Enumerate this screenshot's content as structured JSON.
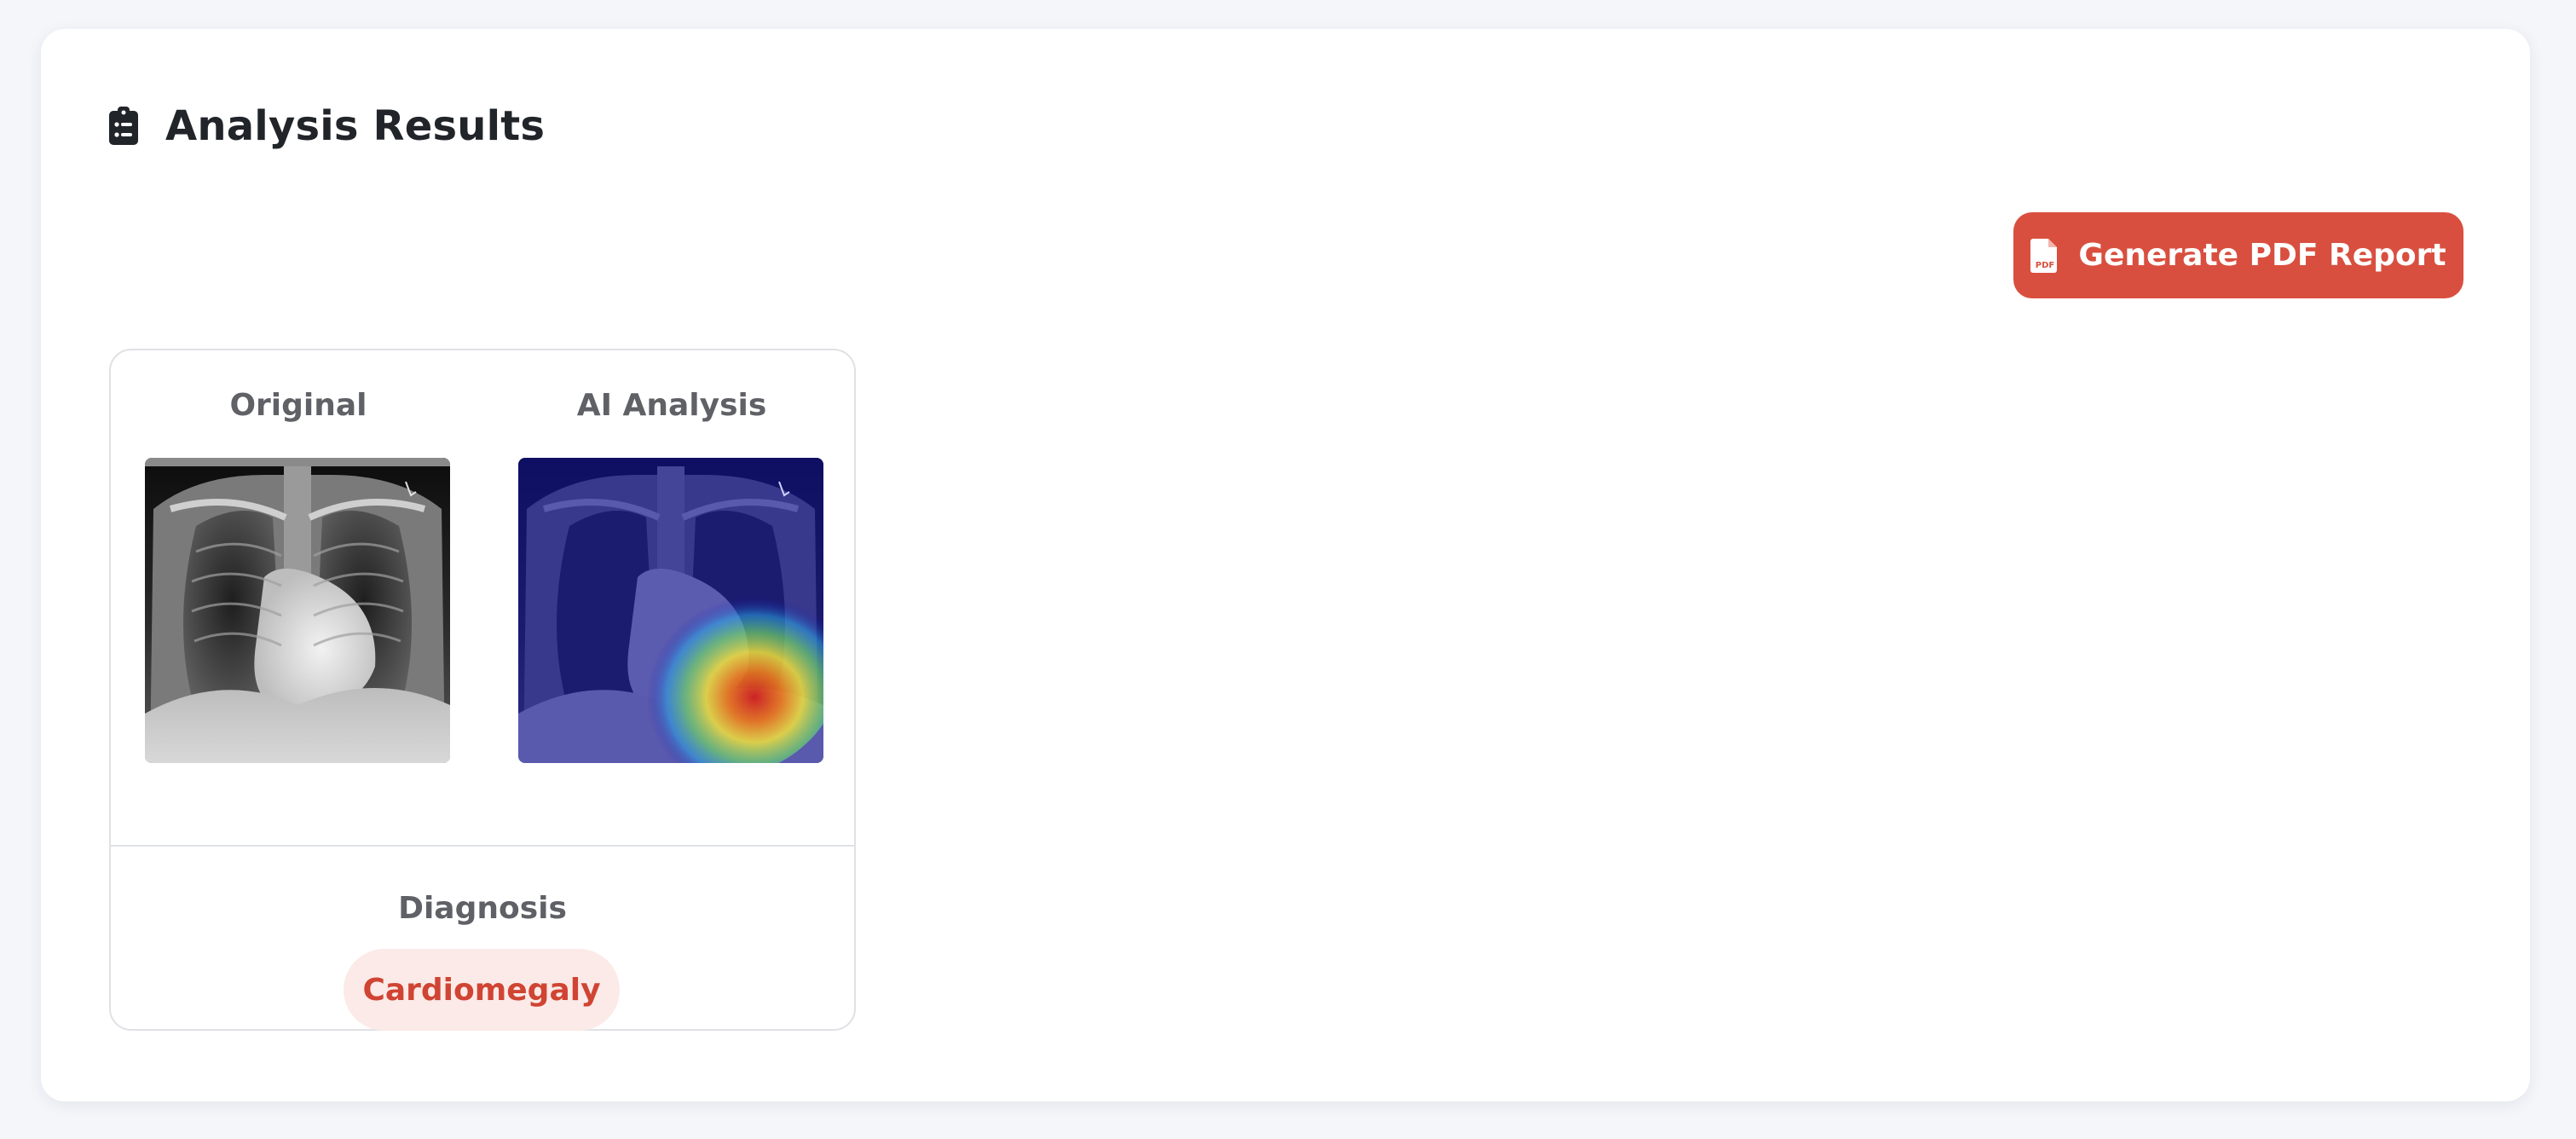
{
  "header": {
    "title": "Analysis Results",
    "icon": "clipboard-list-icon"
  },
  "toolbar": {
    "pdf_button_label": "Generate PDF Report",
    "pdf_icon": "file-pdf-icon"
  },
  "result": {
    "original_label": "Original",
    "ai_label": "AI Analysis",
    "diagnosis_label": "Diagnosis",
    "diagnosis_value": "Cardiomegaly"
  },
  "colors": {
    "accent": "#d94f3f",
    "badge_bg": "#fbeae7",
    "badge_text": "#d04433",
    "page_bg": "#f4f6fa"
  }
}
